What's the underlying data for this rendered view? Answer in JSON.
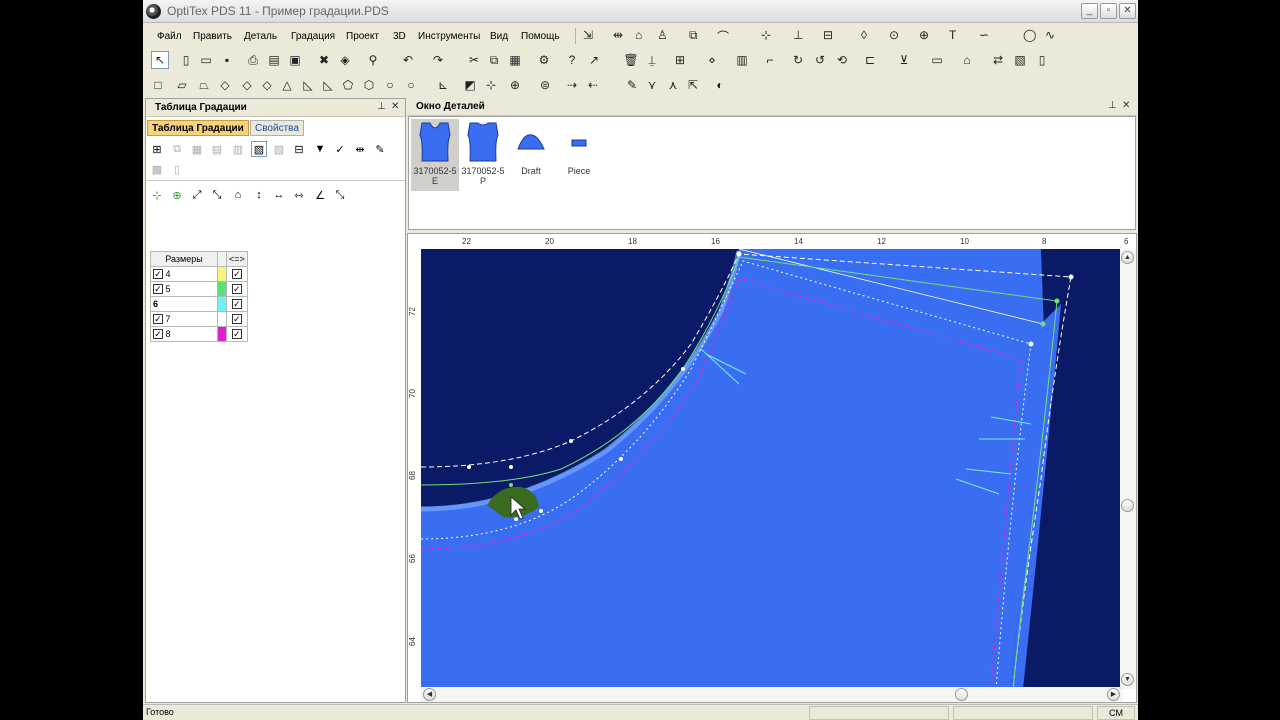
{
  "window": {
    "title": "OptiTex PDS 11 - Пример градации.PDS",
    "controls": [
      "minimize",
      "maximize",
      "close"
    ]
  },
  "menu": [
    "Файл",
    "Править",
    "Деталь",
    "Градация",
    "Проект",
    "3D",
    "Инструменты",
    "Вид",
    "Помощь"
  ],
  "grading_panel": {
    "title": "Таблица Градации",
    "tabs": [
      "Таблица Градации",
      "Свойства"
    ],
    "active_tab": "Таблица Градации",
    "table": {
      "header_sizes": "Размеры",
      "header_link": "<=>",
      "rows": [
        {
          "size": "4",
          "checked": true,
          "color": "#F6F67A",
          "linked": true
        },
        {
          "size": "5",
          "checked": true,
          "color": "#5CE07A",
          "linked": true
        },
        {
          "size": "6",
          "checked": false,
          "base": true,
          "color": "#6EF2F2",
          "linked": true
        },
        {
          "size": "7",
          "checked": true,
          "color": "#FFFFFF",
          "linked": true
        },
        {
          "size": "8",
          "checked": true,
          "color": "#E020D0",
          "linked": true
        }
      ]
    }
  },
  "details_panel": {
    "title": "Окно Деталей",
    "pieces": [
      {
        "label1": "3170052-5",
        "label2": "E",
        "selected": true,
        "icon": "bodice-front-icon"
      },
      {
        "label1": "3170052-5",
        "label2": "P",
        "selected": false,
        "icon": "bodice-back-icon"
      },
      {
        "label1": "Draft",
        "label2": "",
        "selected": false,
        "icon": "draft-curve-icon"
      },
      {
        "label1": "Piece",
        "label2": "",
        "selected": false,
        "icon": "piece-rect-icon"
      }
    ]
  },
  "rulers": {
    "horizontal": [
      "22",
      "20",
      "18",
      "16",
      "14",
      "12",
      "10",
      "8",
      "6"
    ],
    "vertical": [
      "72",
      "70",
      "68",
      "66",
      "64"
    ]
  },
  "canvas": {
    "background": "#0A1A66",
    "piece_fill": "#3A6EF2",
    "accent_green": "#6EE07A",
    "accent_magenta": "#E020D0"
  },
  "status": {
    "text": "Готово",
    "unit": "СМ"
  }
}
